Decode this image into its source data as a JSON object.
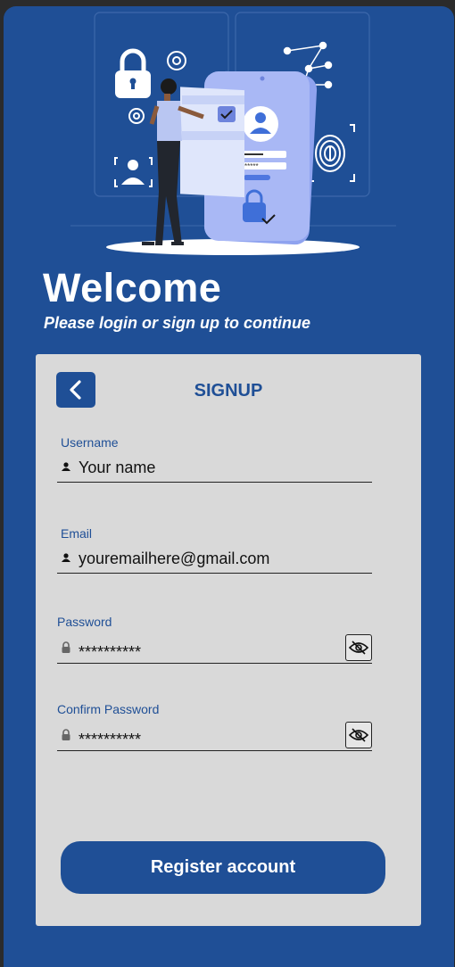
{
  "welcome": {
    "title": "Welcome",
    "subtitle": "Please login or sign up to continue"
  },
  "signup": {
    "title": "SIGNUP",
    "back_icon": "chevron-left-icon",
    "fields": [
      {
        "label": "Username",
        "value": "Your name",
        "icon": "user-icon"
      },
      {
        "label": "Email",
        "value": "youremailhere@gmail.com",
        "icon": "user-icon"
      },
      {
        "label": "Password",
        "value": "**********",
        "icon": "lock-icon",
        "toggle_icon": "eye-off-icon"
      },
      {
        "label": "Confirm Password",
        "value": "**********",
        "icon": "lock-icon",
        "toggle_icon": "eye-off-icon"
      }
    ],
    "register_label": "Register account"
  },
  "hero": {
    "illustration": "security-login-illustration",
    "password_mask": "*****"
  },
  "colors": {
    "primary": "#1f4f96",
    "card": "#d9d9d9",
    "text_dark": "#111111",
    "phone_illustration": "#a9b8f5"
  }
}
